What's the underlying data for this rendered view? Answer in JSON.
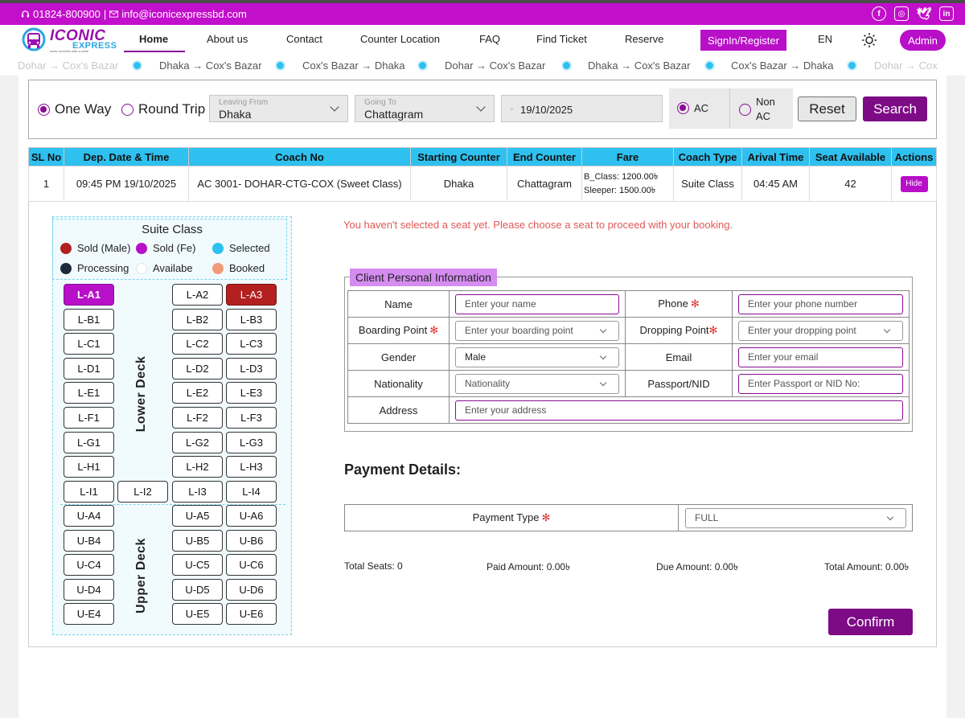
{
  "topbar": {
    "phone": "01824-800900",
    "separator": "|",
    "email": "info@iconicexpressbd.com",
    "social": [
      "facebook-icon",
      "instagram-icon",
      "twitter-icon",
      "linkedin-icon"
    ]
  },
  "brand": {
    "name_line1": "ICONIC",
    "name_line2": "EXPRESS",
    "tagline": "iconic services with a smile"
  },
  "nav": {
    "items": [
      "Home",
      "About us",
      "Contact",
      "Counter Location",
      "FAQ",
      "Find Ticket",
      "Reserve"
    ],
    "active": "Home",
    "signin": "SignIn/Register",
    "lang": "EN",
    "admin": "Admin"
  },
  "ticker": {
    "items": [
      "Dohar → Cox's Bazar",
      "Dhaka → Cox's Bazar",
      "Cox's Bazar → Dhaka",
      "Dohar → Cox's Bazar",
      "Dhaka → Cox's Bazar",
      "Cox's Bazar → Dhaka",
      "Dohar → Cox"
    ]
  },
  "search": {
    "one_way": "One Way",
    "round_trip": "Round Trip",
    "trip_selected": "One Way",
    "leaving_label": "Leaving From",
    "leaving_value": "Dhaka",
    "going_label": "Going To",
    "going_value": "Chattagram",
    "date": "19/10/2025",
    "ac": "AC",
    "non_ac_1": "Non",
    "non_ac_2": "AC",
    "class_selected": "AC",
    "reset": "Reset",
    "submit": "Search"
  },
  "results": {
    "columns": [
      "SL No",
      "Dep. Date & Time",
      "Coach No",
      "Starting Counter",
      "End Counter",
      "Fare",
      "Coach Type",
      "Arival Time",
      "Seat Available",
      "Actions"
    ],
    "rows": [
      {
        "sl": "1",
        "dep": "09:45 PM 19/10/2025",
        "coach": "AC 3001- DOHAR-CTG-COX (Sweet Class)",
        "start": "Dhaka",
        "end": "Chattagram",
        "fare_b_label": "B_Class:",
        "fare_b": "1200.00৳",
        "fare_s_label": "Sleeper:",
        "fare_s": "1500.00৳",
        "type": "Suite Class",
        "arrival": "04:45 AM",
        "seats": "42",
        "action": "Hide"
      }
    ]
  },
  "seatmap": {
    "title": "Suite Class",
    "legend": [
      {
        "label": "Sold (Male)",
        "color": "#b32020"
      },
      {
        "label": "Sold (Fe)",
        "color": "#b80fc8"
      },
      {
        "label": "Selected",
        "color": "#2ec0ef"
      },
      {
        "label": "Processing",
        "color": "#1e2a3a"
      },
      {
        "label": "Availabe",
        "color": "#ffffff"
      },
      {
        "label": "Booked",
        "color": "#f39a78"
      }
    ],
    "lower_label": "Lower Deck",
    "upper_label": "Upper Deck",
    "lower": [
      [
        "L-A1",
        "",
        "L-A2",
        "L-A3"
      ],
      [
        "L-B1",
        "",
        "L-B2",
        "L-B3"
      ],
      [
        "L-C1",
        "",
        "L-C2",
        "L-C3"
      ],
      [
        "L-D1",
        "",
        "L-D2",
        "L-D3"
      ],
      [
        "L-E1",
        "",
        "L-E2",
        "L-E3"
      ],
      [
        "L-F1",
        "",
        "L-F2",
        "L-F3"
      ],
      [
        "L-G1",
        "",
        "L-G2",
        "L-G3"
      ],
      [
        "L-H1",
        "",
        "L-H2",
        "L-H3"
      ],
      [
        "L-I1",
        "L-I2",
        "L-I3",
        "L-I4"
      ]
    ],
    "upper": [
      [
        "U-A4",
        "",
        "U-A5",
        "U-A6"
      ],
      [
        "U-B4",
        "",
        "U-B5",
        "U-B6"
      ],
      [
        "U-C4",
        "",
        "U-C5",
        "U-C6"
      ],
      [
        "U-D4",
        "",
        "U-D5",
        "U-D6"
      ],
      [
        "U-E4",
        "",
        "U-E5",
        "U-E6"
      ]
    ],
    "sold_female": [
      "L-A1"
    ],
    "sold_male": [
      "L-A3"
    ]
  },
  "warning": "You haven't selected a seat yet. Please choose a seat to proceed with your booking.",
  "client": {
    "legend": "Client Personal Information",
    "name_label": "Name",
    "name_ph": "Enter your name",
    "phone_label": "Phone",
    "phone_ph": "Enter your phone number",
    "boarding_label": "Boarding Point",
    "boarding_ph": "Enter your boarding point",
    "dropping_label": "Dropping Point",
    "dropping_ph": "Enter your dropping point",
    "gender_label": "Gender",
    "gender_value": "Male",
    "email_label": "Email",
    "email_ph": "Enter your email",
    "nationality_label": "Nationality",
    "nationality_value": "Nationality",
    "passport_label": "Passport/NID",
    "passport_ph": "Enter Passport or NID No:",
    "address_label": "Address",
    "address_ph": "Enter your address",
    "required_mark": "✻"
  },
  "payment": {
    "title": "Payment Details:",
    "type_label": "Payment Type",
    "type_value": "FULL",
    "total_seats": "Total Seats: 0",
    "paid": "Paid Amount: 0.00৳",
    "due": "Due Amount: 0.00৳",
    "total": "Total Amount: 0.00৳",
    "confirm": "Confirm"
  }
}
